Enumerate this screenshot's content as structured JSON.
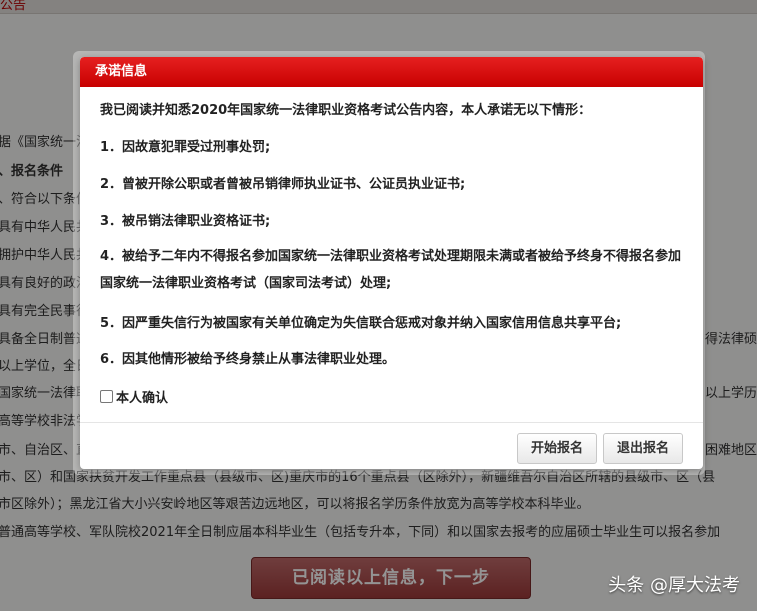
{
  "background": {
    "topbar_text": "公告",
    "left_fragments": [
      {
        "text": "据《国家统一法",
        "top": 0
      },
      {
        "text": "、报名条件",
        "top": 0
      },
      {
        "text": "、符合以下条件",
        "top": 0
      },
      {
        "text": "具有中华人民共",
        "top": 0
      },
      {
        "text": "拥护中华人民共",
        "top": 0
      },
      {
        "text": "具有良好的政治",
        "top": 0
      },
      {
        "text": "具有完全民事行",
        "top": 0
      },
      {
        "text": "具备全日制普通",
        "top": 0
      },
      {
        "text": "以上学位，全日",
        "top": 0
      },
      {
        "text": "国家统一法律职",
        "top": 0
      },
      {
        "text": "高等学校非法学本",
        "top": 0
      }
    ],
    "right_fragments": [
      "得法律硕",
      "以上学历",
      "困难地区"
    ],
    "line_13": "市、自治区、直",
    "line_14": "市、区）和国家扶贫开发工作重点县（县级市、区)重庆市的16个重点县（区除外），新疆维吾尔自治区所辖的县级市、区（县",
    "line_15": "市区除外）；黑龙江省大小兴安岭地区等艰苦边远地区，可以将报名学历条件放宽为高等学校本科毕业。",
    "line_16": "普通高等学校、军队院校2021年全日制应届本科毕业生（包括专升本，下同）和以国家去报考的应届硕士毕业生可以报名参加",
    "next_button": "已阅读以上信息，下一步"
  },
  "modal": {
    "title": "承诺信息",
    "intro": "我已阅读并知悉2020年国家统一法律职业资格考试公告内容，本人承诺无以下情形：",
    "clauses": [
      "1．因故意犯罪受过刑事处罚;",
      "2．曾被开除公职或者曾被吊销律师执业证书、公证员执业证书;",
      "3．被吊销法律职业资格证书;",
      "4．被给予二年内不得报名参加国家统一法律职业资格考试处理期限未满或者被给予终身不得报名参加国家统一法律职业资格考试（国家司法考试）处理;",
      "5．因严重失信行为被国家有关单位确定为失信联合惩戒对象并纳入国家信用信息共享平台;",
      "6．因其他情形被给予终身禁止从事法律职业处理。"
    ],
    "confirm_label": "本人确认",
    "start_button": "开始报名",
    "exit_button": "退出报名"
  },
  "watermark": "头条 @厚大法考",
  "colors": {
    "header_red": "#d40000",
    "next_button": "#a84848"
  }
}
